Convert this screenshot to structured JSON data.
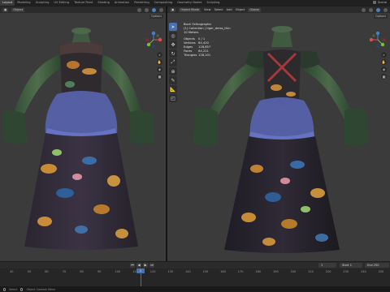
{
  "workspaces": [
    "Layout",
    "Modeling",
    "Sculpting",
    "UV Editing",
    "Texture Paint",
    "Shading",
    "Animation",
    "Rendering",
    "Compositing",
    "Geometry Nodes",
    "Scripting"
  ],
  "active_workspace": "Layout",
  "scene_label": "Scene",
  "left_viewport": {
    "header": [
      "Object"
    ],
    "view_label": "View",
    "options_label": "Options"
  },
  "right_viewport": {
    "mode": "Object Mode",
    "menus": [
      "View",
      "Select",
      "Add",
      "Object"
    ],
    "transform": "Global",
    "options_label": "Options"
  },
  "stats": {
    "view_name": "Back Orthographic",
    "collection": "(1) Collection | tiger_dress_thin",
    "scale": "10 Meters",
    "rows": [
      {
        "k": "Objects",
        "v": "0 / 1"
      },
      {
        "k": "Vertices",
        "v": "64,420"
      },
      {
        "k": "Edges",
        "v": "128,857"
      },
      {
        "k": "Faces",
        "v": "64,221"
      },
      {
        "k": "Triangles",
        "v": "128,101"
      }
    ]
  },
  "timeline": {
    "ruler": [
      "40",
      "50",
      "60",
      "70",
      "80",
      "90",
      "100",
      "110",
      "120",
      "130",
      "140",
      "150",
      "160",
      "170",
      "180",
      "190",
      "200",
      "210",
      "220",
      "230",
      "240",
      "250"
    ],
    "current_frame": "1",
    "start_label": "Start",
    "start_value": "1",
    "end_label": "End",
    "end_value": "250",
    "playhead": "1"
  },
  "statusbar": {
    "items": [
      "Select",
      "Object Context Menu"
    ]
  },
  "colors": {
    "accent": "#4772b3",
    "x_axis": "#e44b53",
    "y_axis": "#7fbb3a",
    "z_axis": "#3f83d8"
  }
}
